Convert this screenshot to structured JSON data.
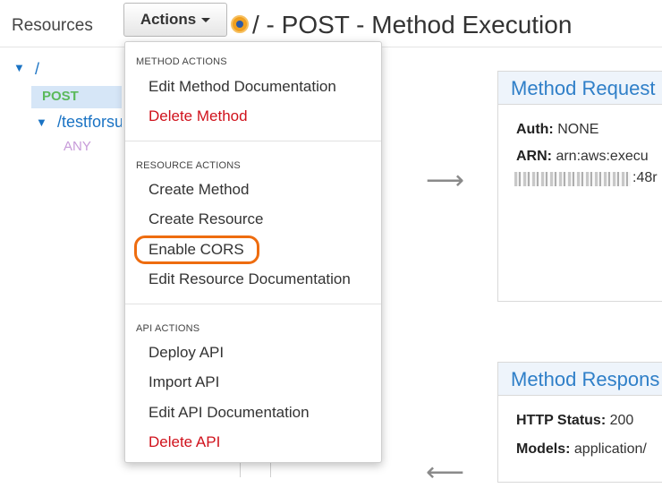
{
  "resources": {
    "title": "Resources",
    "root": "/",
    "method_post": "POST",
    "sub_resource": "/testforsu",
    "method_any": "ANY"
  },
  "header": {
    "actions_label": "Actions",
    "page_title": "/ - POST - Method Execution"
  },
  "menu": {
    "method_actions": {
      "heading": "METHOD ACTIONS",
      "items": [
        "Edit Method Documentation",
        "Delete Method"
      ]
    },
    "resource_actions": {
      "heading": "RESOURCE ACTIONS",
      "items": [
        "Create Method",
        "Create Resource",
        "Enable CORS",
        "Edit Resource Documentation"
      ]
    },
    "api_actions": {
      "heading": "API ACTIONS",
      "items": [
        "Deploy API",
        "Import API",
        "Edit API Documentation",
        "Delete API"
      ]
    }
  },
  "method_request": {
    "title": "Method Request",
    "auth_key": "Auth:",
    "auth_value": "NONE",
    "arn_key": "ARN:",
    "arn_value": "arn:aws:execu",
    "arn_tail": ":48r"
  },
  "method_response": {
    "title": "Method Respons",
    "status_key": "HTTP Status:",
    "status_value": "200",
    "models_key": "Models:",
    "models_value": "application/"
  },
  "colors": {
    "accent": "#2f7fc8",
    "danger": "#d0121c",
    "highlight_ring": "#ee6c0f",
    "post_method": "#5bb95b",
    "any_method": "#c79bd9"
  }
}
